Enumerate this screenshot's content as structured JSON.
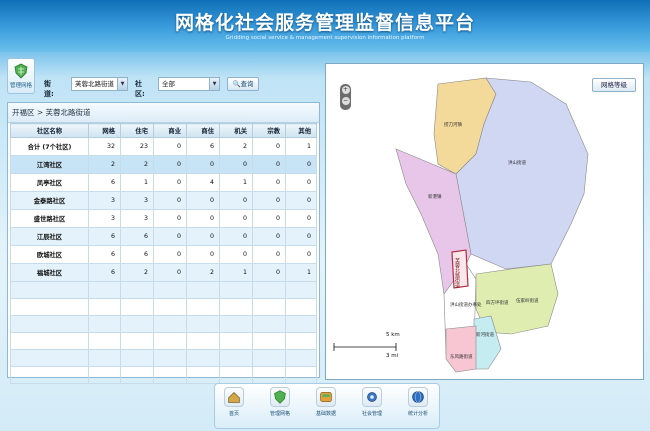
{
  "header": {
    "title": "网格化社会服务管理监督信息平台",
    "subtitle": "Gridding social service & management supervision information platform"
  },
  "module": {
    "label": "管理网格",
    "icon": "shield-grid-icon"
  },
  "filters": {
    "street_label": "街道:",
    "street_value": "芙蓉北路街道",
    "community_label": "社区:",
    "community_value": "全部",
    "search_label": "查询",
    "search_icon": "search-icon"
  },
  "breadcrumb": {
    "text": "开福区 > 芙蓉北路街道"
  },
  "table": {
    "headers": [
      "社区名称",
      "网格",
      "住宅",
      "商业",
      "商住",
      "机关",
      "宗教",
      "其他"
    ],
    "rows": [
      [
        "合计 (7个社区)",
        "32",
        "23",
        "0",
        "6",
        "2",
        "0",
        "1"
      ],
      [
        "江湾社区",
        "2",
        "2",
        "0",
        "0",
        "0",
        "0",
        "0"
      ],
      [
        "凤亭社区",
        "6",
        "1",
        "0",
        "4",
        "1",
        "0",
        "0"
      ],
      [
        "金泰路社区",
        "3",
        "3",
        "0",
        "0",
        "0",
        "0",
        "0"
      ],
      [
        "盛世路社区",
        "3",
        "3",
        "0",
        "0",
        "0",
        "0",
        "0"
      ],
      [
        "江辰社区",
        "6",
        "6",
        "0",
        "0",
        "0",
        "0",
        "0"
      ],
      [
        "欧城社区",
        "6",
        "6",
        "0",
        "0",
        "0",
        "0",
        "0"
      ],
      [
        "福城社区",
        "6",
        "2",
        "0",
        "2",
        "1",
        "0",
        "1"
      ]
    ]
  },
  "map": {
    "button_label": "网格等级",
    "zoom_in": "+",
    "zoom_out": "−",
    "scale_km": "5 km",
    "scale_mi": "3 mi",
    "street_label": "芙蓉北路街道",
    "region_labels": [
      "捞刀河镇",
      "新港镇",
      "洪山街道",
      "伍家岭街道",
      "四方坪街道",
      "洪山街道办事处",
      "新河街道",
      "东风路街道"
    ],
    "region_colors": [
      "#f3d99a",
      "#cfd7f3",
      "#e7c6e9",
      "#dfeeb0",
      "#c5ecf0",
      "#f7c6d2"
    ]
  },
  "nav": [
    {
      "label": "首页",
      "icon": "home-icon"
    },
    {
      "label": "管理网格",
      "icon": "grid-icon"
    },
    {
      "label": "基础数据",
      "icon": "database-icon"
    },
    {
      "label": "社会管理",
      "icon": "gear-icon"
    },
    {
      "label": "统计分析",
      "icon": "globe-icon"
    }
  ]
}
